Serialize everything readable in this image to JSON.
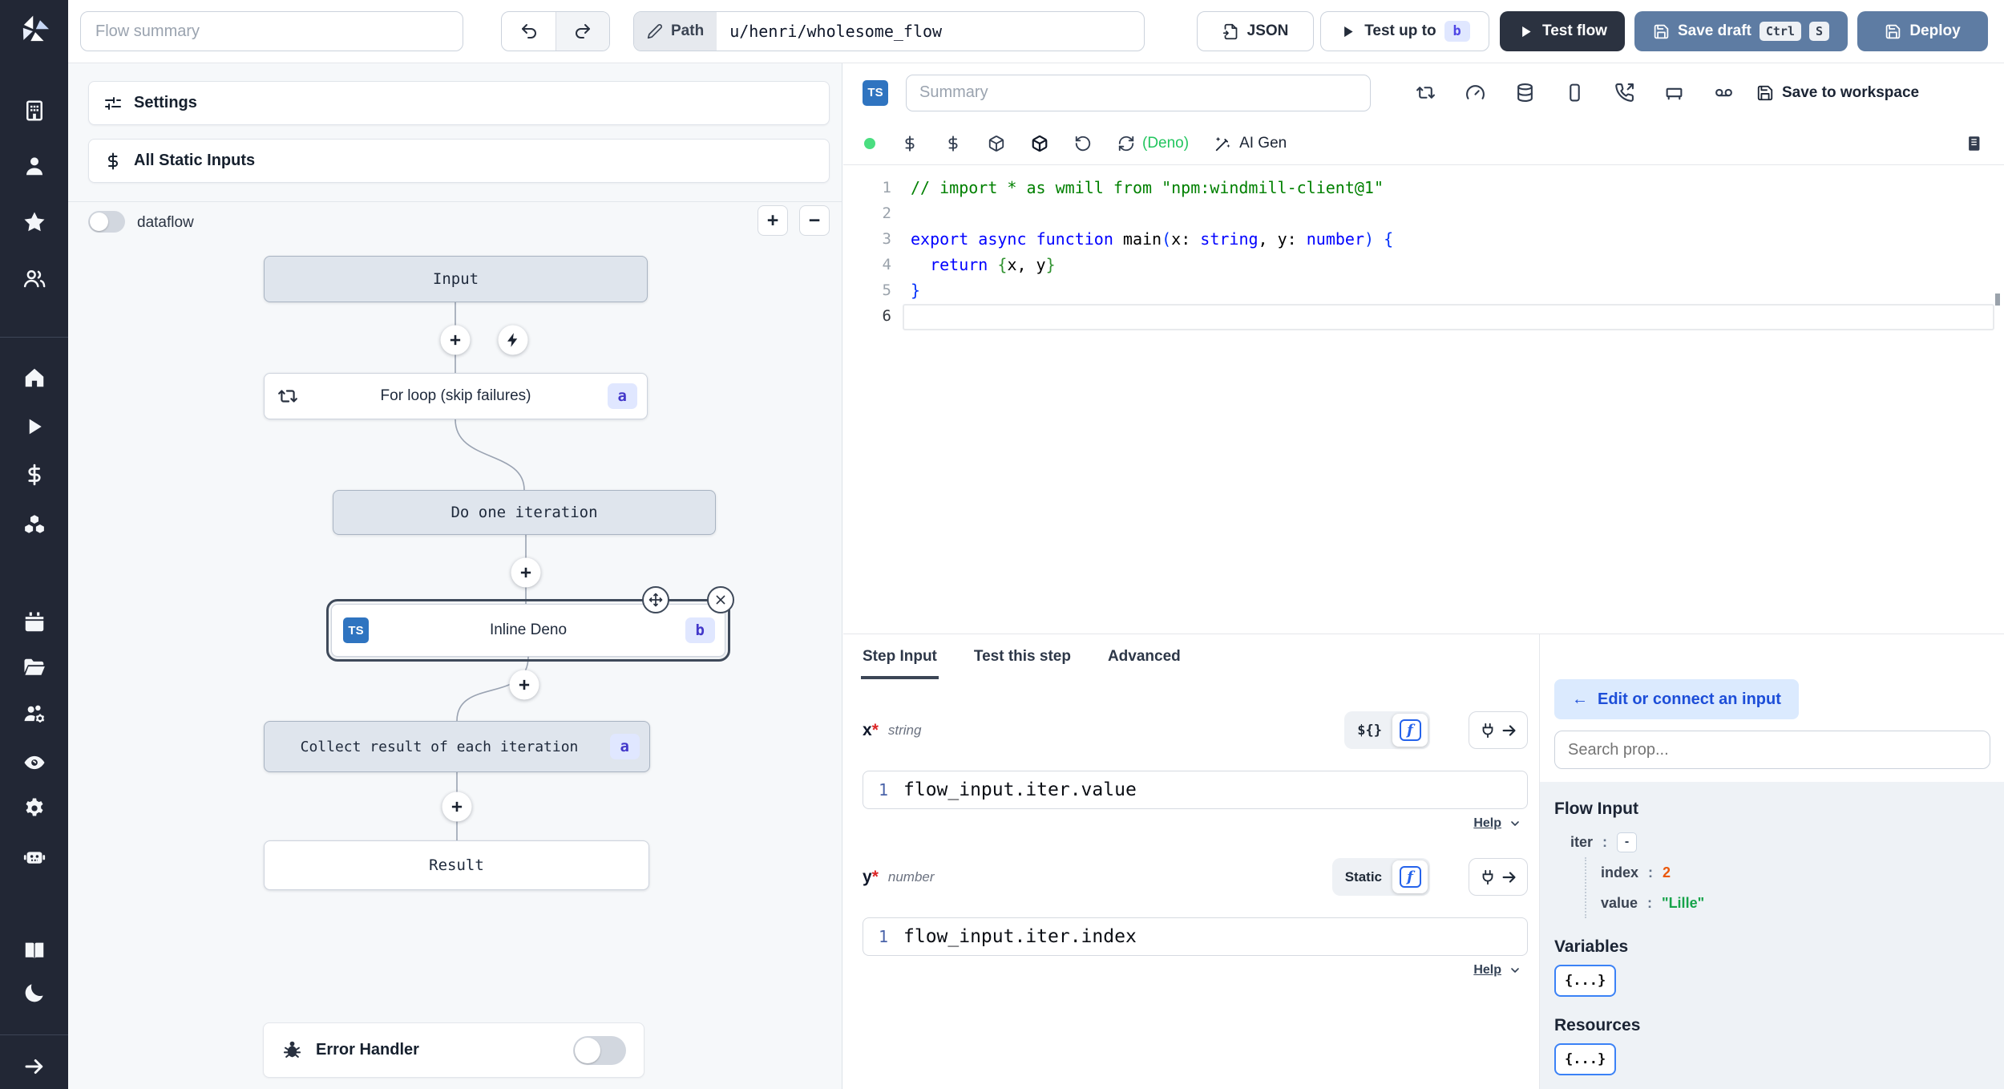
{
  "topbar": {
    "flow_summary_placeholder": "Flow summary",
    "path_label": "Path",
    "path_value": "u/henri/wholesome_flow",
    "json_button": "JSON",
    "test_up_to_label": "Test up to",
    "test_up_to_badge": "b",
    "test_flow_label": "Test flow",
    "save_draft_label": "Save draft",
    "kbd_ctrl": "Ctrl",
    "kbd_s": "S",
    "deploy_label": "Deploy"
  },
  "flow_panel": {
    "settings_label": "Settings",
    "static_inputs_label": "All Static Inputs",
    "dataflow_label": "dataflow",
    "zoom_in": "+",
    "zoom_out": "−",
    "nodes": {
      "input": {
        "label": "Input"
      },
      "forloop": {
        "label": "For loop (skip failures)",
        "badge": "a"
      },
      "do_one": {
        "label": "Do one iteration"
      },
      "inline": {
        "label": "Inline Deno",
        "badge": "b",
        "lang": "TS"
      },
      "collect": {
        "label": "Collect result of each iteration",
        "badge": "a"
      },
      "result": {
        "label": "Result"
      }
    },
    "error_handler_label": "Error Handler"
  },
  "editor": {
    "lang_badge": "TS",
    "summary_placeholder": "Summary",
    "deno_label": "(Deno)",
    "ai_gen_label": "AI Gen",
    "save_to_workspace_label": "Save to workspace",
    "code": {
      "lines": [
        {
          "num": "1",
          "tokens": [
            {
              "c": "cmt",
              "t": "// import * as wmill from \"npm:windmill-client@1\""
            }
          ]
        },
        {
          "num": "2",
          "tokens": []
        },
        {
          "num": "3",
          "tokens": [
            {
              "c": "kw",
              "t": "export"
            },
            {
              "c": "pl",
              "t": " "
            },
            {
              "c": "kw",
              "t": "async"
            },
            {
              "c": "pl",
              "t": " "
            },
            {
              "c": "kw",
              "t": "function"
            },
            {
              "c": "pl",
              "t": " main"
            },
            {
              "c": "b1",
              "t": "("
            },
            {
              "c": "pl",
              "t": "x: "
            },
            {
              "c": "kw",
              "t": "string"
            },
            {
              "c": "pl",
              "t": ", y: "
            },
            {
              "c": "kw",
              "t": "number"
            },
            {
              "c": "b1",
              "t": ")"
            },
            {
              "c": "pl",
              "t": " "
            },
            {
              "c": "b1",
              "t": "{"
            }
          ]
        },
        {
          "num": "4",
          "tokens": [
            {
              "c": "pl",
              "t": "  "
            },
            {
              "c": "kw",
              "t": "return"
            },
            {
              "c": "pl",
              "t": " "
            },
            {
              "c": "b2",
              "t": "{"
            },
            {
              "c": "pl",
              "t": "x, y"
            },
            {
              "c": "b2",
              "t": "}"
            }
          ]
        },
        {
          "num": "5",
          "tokens": [
            {
              "c": "b1",
              "t": "}"
            }
          ]
        },
        {
          "num": "6",
          "tokens": [],
          "active": true
        }
      ]
    }
  },
  "step_panel": {
    "tabs": [
      "Step Input",
      "Test this step",
      "Advanced"
    ],
    "fields": [
      {
        "name": "x",
        "required": "*",
        "type": "string",
        "mode": "${}",
        "line_num": "1",
        "value": "flow_input.iter.value",
        "help_label": "Help"
      },
      {
        "name": "y",
        "required": "*",
        "type": "number",
        "mode": "Static",
        "line_num": "1",
        "value": "flow_input.iter.index",
        "help_label": "Help"
      }
    ]
  },
  "props_panel": {
    "back_arrow": "←",
    "edit_connect_label": "Edit or connect an input",
    "search_placeholder": "Search prop...",
    "flow_input_title": "Flow Input",
    "tree": {
      "colon": ":",
      "iter_key": "iter",
      "iter_toggle": "-",
      "index_key": "index",
      "index_value": "2",
      "value_key": "value",
      "value_value": "\"Lille\""
    },
    "variables_title": "Variables",
    "variables_button": "{...}",
    "resources_title": "Resources",
    "resources_button": "{...}"
  },
  "sidebar_icons": [
    "building",
    "user",
    "star",
    "users",
    "home",
    "play",
    "dollar",
    "boxes",
    "calendar",
    "folder-open",
    "users-cog",
    "eye",
    "gear",
    "robot",
    "book-open",
    "moon",
    "arrow-right"
  ],
  "colors": {
    "sidebar_bg": "#222735",
    "steel_button": "#5e7ca3",
    "dark_button": "#2b3240",
    "badge_bg": "#e0e7ff",
    "badge_text": "#4338ca",
    "deno_green": "#22c55e",
    "status_green": "#4ade80",
    "index_orange": "#ea580c",
    "string_green": "#16a34a",
    "accent_blue": "#2563eb"
  }
}
